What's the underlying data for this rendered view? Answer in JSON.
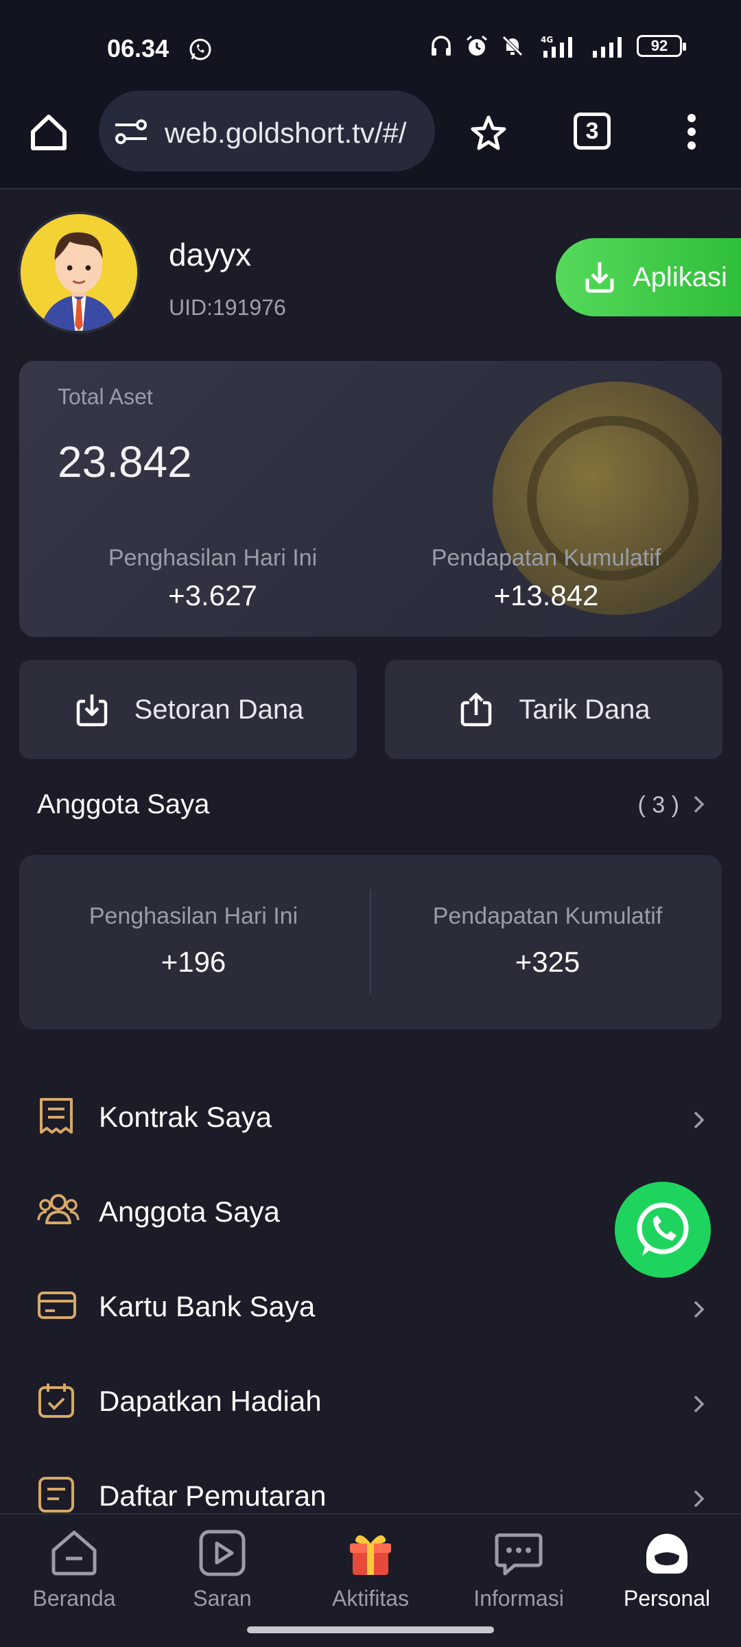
{
  "status_bar": {
    "time": "06.34",
    "battery": "92"
  },
  "browser": {
    "url": "web.goldshort.tv/#/",
    "tab_count": "3"
  },
  "profile": {
    "username": "dayyx",
    "uid": "UID:191976",
    "app_button": "Aplikasi"
  },
  "assets": {
    "label": "Total Aset",
    "total": "23.842",
    "today_label": "Penghasilan Hari Ini",
    "today_value": "+3.627",
    "cumulative_label": "Pendapatan Kumulatif",
    "cumulative_value": "+13.842"
  },
  "actions": {
    "deposit": "Setoran Dana",
    "withdraw": "Tarik Dana"
  },
  "members": {
    "title": "Anggota Saya",
    "count": "( 3 )",
    "today_label": "Penghasilan Hari Ini",
    "today_value": "+196",
    "cumulative_label": "Pendapatan Kumulatif",
    "cumulative_value": "+325"
  },
  "menu": [
    {
      "label": "Kontrak Saya",
      "icon": "contract-icon"
    },
    {
      "label": "Anggota Saya",
      "icon": "members-icon"
    },
    {
      "label": "Kartu Bank Saya",
      "icon": "bank-card-icon"
    },
    {
      "label": "Dapatkan Hadiah",
      "icon": "calendar-check-icon"
    },
    {
      "label": "Daftar Pemutaran",
      "icon": "playlist-icon"
    }
  ],
  "nav": [
    {
      "label": "Beranda",
      "icon": "home-icon"
    },
    {
      "label": "Saran",
      "icon": "play-icon"
    },
    {
      "label": "Aktifitas",
      "icon": "gift-icon"
    },
    {
      "label": "Informasi",
      "icon": "chat-icon"
    },
    {
      "label": "Personal",
      "icon": "personal-icon"
    }
  ],
  "colors": {
    "accent_green": "#3fca44",
    "icon_gold": "#d7a868",
    "background": "#1b1c28"
  }
}
